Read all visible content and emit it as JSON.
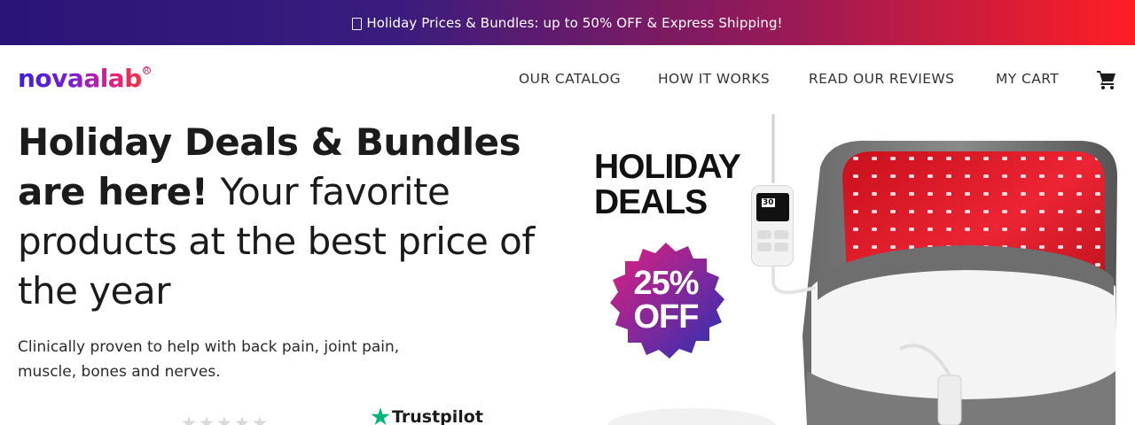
{
  "announcement": {
    "icon": "gift-icon",
    "text": "Holiday Prices & Bundles: up to 50% OFF & Express Shipping!"
  },
  "brand": {
    "logo_text": "novaalab",
    "registered_mark": "R"
  },
  "nav": {
    "items": [
      {
        "label": "OUR CATALOG"
      },
      {
        "label": "HOW IT WORKS"
      },
      {
        "label": "READ OUR REVIEWS"
      },
      {
        "label": "MY CART"
      }
    ],
    "cart_icon": "shopping-cart-icon"
  },
  "hero": {
    "title_bold": "Holiday Deals & Bundles are here!",
    "title_light": "Your favorite products at the best price of the year",
    "subtitle": "Clinically proven to help with back pain, joint pain, muscle, bones and nerves.",
    "trustpilot_label": "Trustpilot",
    "rating_stars": 5
  },
  "product_image": {
    "deals_line1": "HOLIDAY",
    "deals_line2": "DEALS",
    "badge_line1": "25%",
    "badge_line2": "OFF",
    "controller_display": "30"
  },
  "colors": {
    "belt_red": "#e11b2b",
    "belt_gray": "#5a5a5a",
    "badge_start": "#e3207f",
    "badge_end": "#2a2fb3",
    "trustpilot_green": "#00b67a"
  }
}
